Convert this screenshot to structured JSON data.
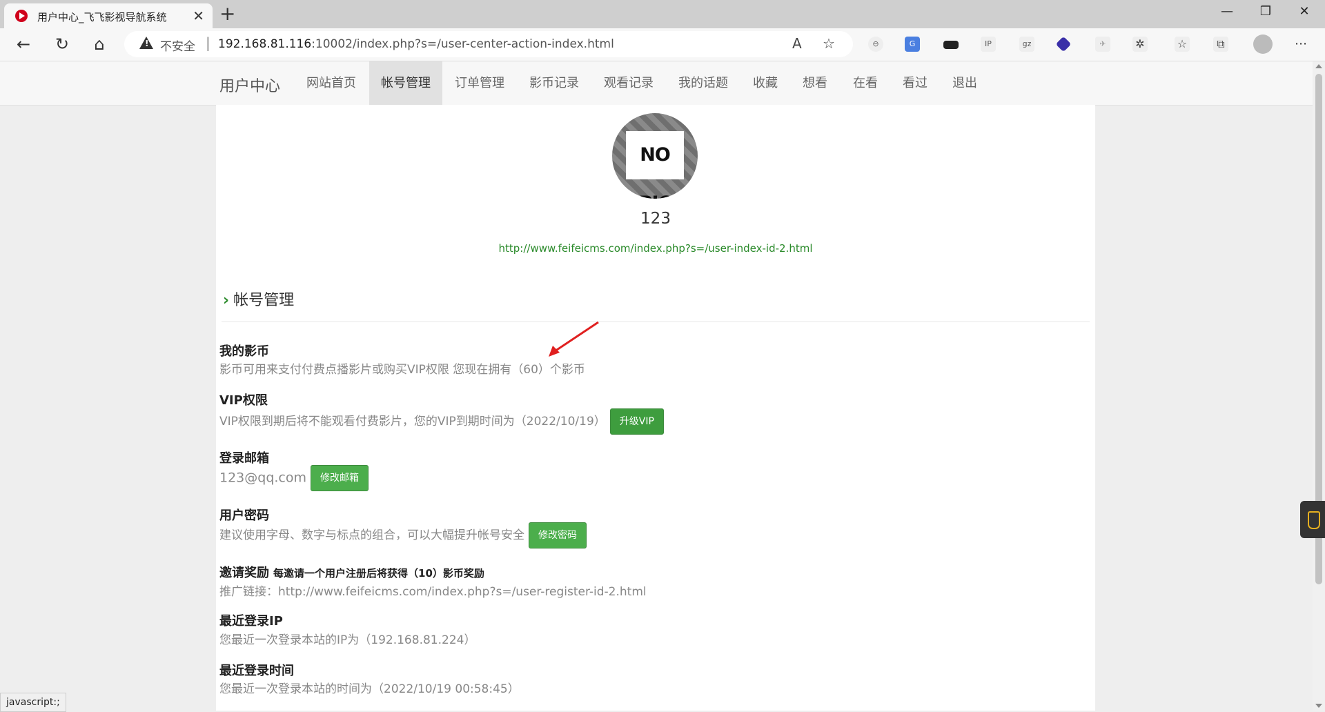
{
  "browser": {
    "tab_title": "用户中心_飞飞影视导航系统",
    "new_tab": "+",
    "win_min": "—",
    "win_restore": "❐",
    "win_close": "✕",
    "insecure_label": "不安全",
    "url_host": "192.168.81.116",
    "url_rest": ":10002/index.php?s=/user-center-action-index.html",
    "status_text": "javascript:;"
  },
  "site": {
    "brand": "用户中心",
    "nav": [
      "网站首页",
      "帐号管理",
      "订单管理",
      "影币记录",
      "观看记录",
      "我的话题",
      "收藏",
      "想看",
      "在看",
      "看过",
      "退出"
    ],
    "active_nav": "帐号管理"
  },
  "profile": {
    "avatar_text": "NO PIC",
    "username": "123",
    "home_link": "http://www.feifeicms.com/index.php?s=/user-index-id-2.html"
  },
  "section": {
    "title": "帐号管理",
    "coins": {
      "title": "我的影币",
      "desc": "影币可用来支付付费点播影片或购买VIP权限 您现在拥有（60）个影币"
    },
    "vip": {
      "title": "VIP权限",
      "desc": "VIP权限到期后将不能观看付费影片，您的VIP到期时间为（2022/10/19）",
      "button": "升级VIP"
    },
    "email": {
      "title": "登录邮箱",
      "value": "123@qq.com",
      "button": "修改邮箱"
    },
    "password": {
      "title": "用户密码",
      "desc": "建议使用字母、数字与标点的组合，可以大幅提升帐号安全",
      "button": "修改密码"
    },
    "invite": {
      "title": "邀请奖励",
      "sub": "每邀请一个用户注册后将获得（10）影币奖励",
      "desc": "推广链接：http://www.feifeicms.com/index.php?s=/user-register-id-2.html"
    },
    "last_ip": {
      "title": "最近登录IP",
      "desc": "您最近一次登录本站的IP为（192.168.81.224）"
    },
    "last_time": {
      "title": "最近登录时间",
      "desc": "您最近一次登录本站的时间为（2022/10/19 00:58:45）"
    }
  },
  "colors": {
    "accent_green": "#4cae4c",
    "link_green": "#2a8a2a",
    "annotation_red": "#e02020"
  }
}
